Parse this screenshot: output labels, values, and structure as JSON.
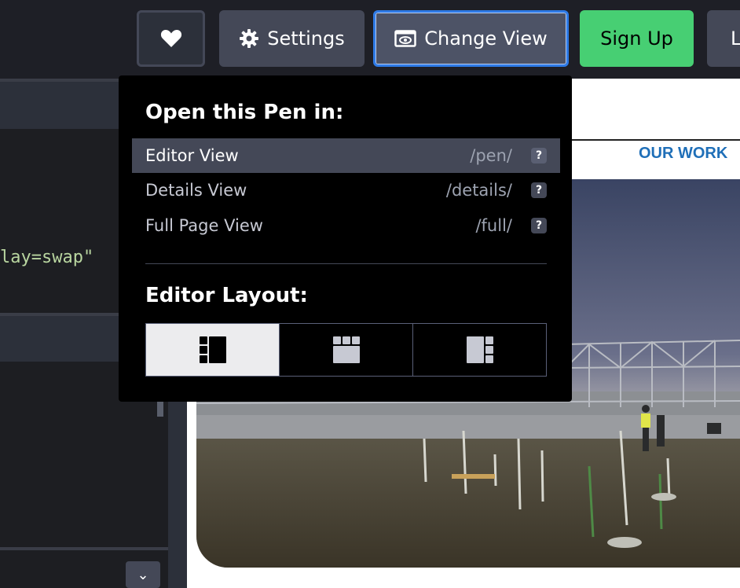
{
  "header": {
    "settings_label": "Settings",
    "change_view_label": "Change View",
    "signup_label": "Sign Up",
    "login_label": "L"
  },
  "editor": {
    "code_line": "lay=swap\""
  },
  "preview": {
    "nav_link": "OUR WORK"
  },
  "dropdown": {
    "open_title": "Open this Pen in:",
    "views": [
      {
        "label": "Editor View",
        "path": "/pen/",
        "active": true
      },
      {
        "label": "Details View",
        "path": "/details/",
        "active": false
      },
      {
        "label": "Full Page View",
        "path": "/full/",
        "active": false
      }
    ],
    "help_glyph": "?",
    "layout_title": "Editor Layout:",
    "layouts": [
      "layout-left",
      "layout-top",
      "layout-right"
    ],
    "selected_layout": "layout-left"
  },
  "colors": {
    "accent_blue": "#2e7ae6",
    "signup_green": "#47cf73",
    "link_blue": "#1f6fb8"
  }
}
